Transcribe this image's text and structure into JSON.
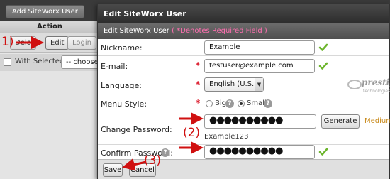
{
  "background": {
    "add_user_button": "Add SiteWorx User",
    "action_header": "Action",
    "delete_button": "Dele",
    "edit_button": "Edit",
    "login_button": "Login",
    "with_selected": "With Selected:",
    "choose_select": "-- choose --"
  },
  "modal": {
    "title": "Edit SiteWorx User",
    "subtitle": "Edit SiteWorx User",
    "required_note": "( *Denotes Required Field )",
    "fields": {
      "nickname": {
        "label": "Nickname:",
        "value": "Example"
      },
      "email": {
        "label": "E-mail:",
        "value": "testuser@example.com"
      },
      "language": {
        "label": "Language:",
        "value": "English (U.S.)"
      },
      "menu_style": {
        "label": "Menu Style:",
        "options": [
          "Big",
          "Small"
        ],
        "selected": "Small"
      },
      "change_password": {
        "label": "Change Password:",
        "value": "●●●●●●●●●●",
        "generate_button": "Generate",
        "strength": "Medium",
        "generated_text": "Example123"
      },
      "confirm_password": {
        "label": "Confirm Password:",
        "value": "●●●●●●●●●●"
      }
    },
    "required_marker": "*",
    "save_button": "Save",
    "cancel_button": "Cancel",
    "logo_text": "prestige",
    "logo_sub": "technologies"
  },
  "annotations": {
    "step1": "1)",
    "step2": "(2)",
    "step3": "(3)"
  },
  "colors": {
    "annotation": "#d01010",
    "required": "#dd2233",
    "required_note": "#ff6fb0",
    "strength_medium": "#c8891a",
    "check_green": "#6cb52d"
  },
  "icons": {
    "valid": "check-icon",
    "help": "help-icon",
    "select_arrow": "chevron-down-icon"
  }
}
